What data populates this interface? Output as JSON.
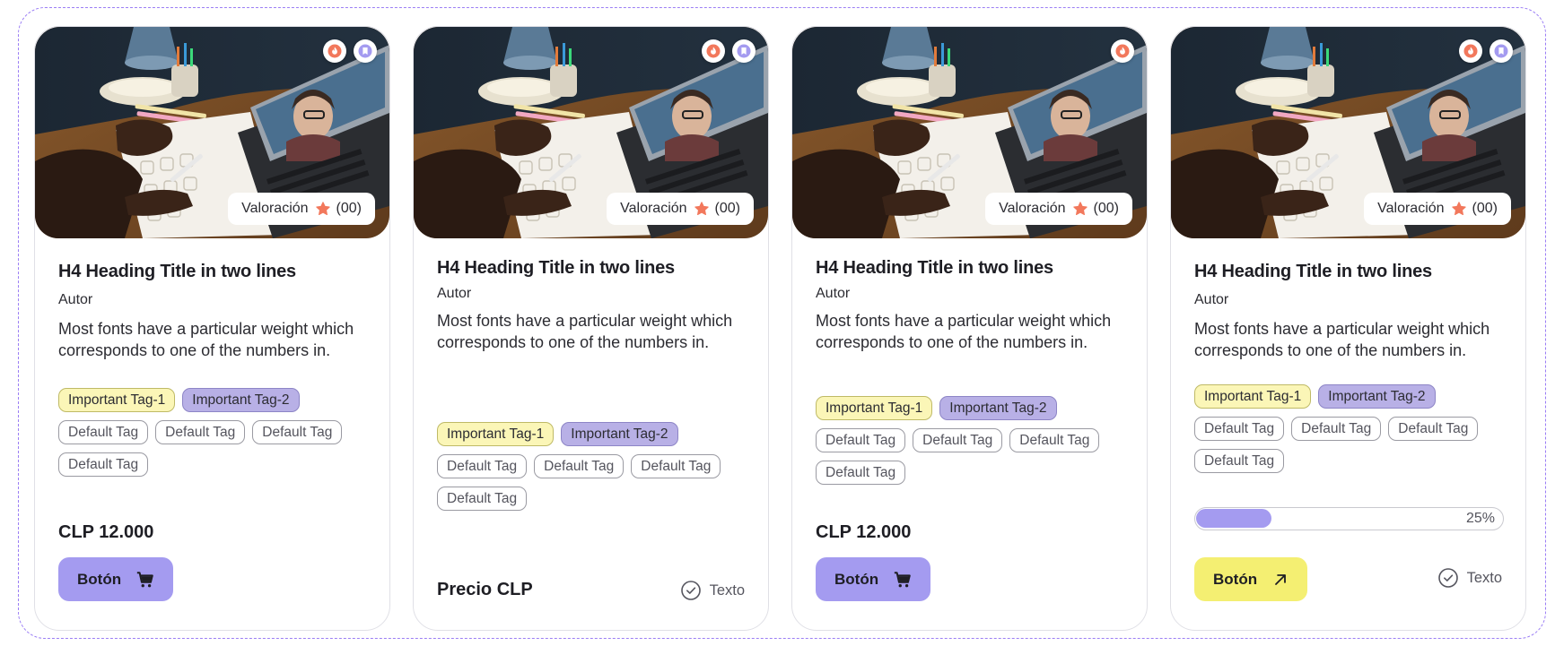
{
  "colors": {
    "brand_purple": "#a49bf0",
    "brand_yellow": "#f4ef72",
    "badge_orange": "#f2785c",
    "star_orange": "#f2785c"
  },
  "cards": [
    {
      "rating": {
        "label": "Valoración",
        "count": "(00)",
        "icon": "star-icon"
      },
      "badges": [
        "flame-icon",
        "bookmark-icon"
      ],
      "title": "H4 Heading Title in two lines",
      "author": "Autor",
      "description": "Most fonts have a particular weight which corresponds to one of the numbers in.",
      "tags": {
        "important": [
          "Important Tag-1",
          "Important Tag-2"
        ],
        "defaults": [
          "Default Tag",
          "Default Tag",
          "Default Tag",
          "Default Tag"
        ]
      },
      "price": "CLP 12.000",
      "button": {
        "label": "Botón",
        "icon": "cart-icon"
      }
    },
    {
      "rating": {
        "label": "Valoración",
        "count": "(00)",
        "icon": "star-icon"
      },
      "badges": [
        "flame-icon",
        "bookmark-icon"
      ],
      "title": "H4 Heading Title in two lines",
      "author": "Autor",
      "description": "Most fonts have a particular weight which corresponds to one of the numbers in.",
      "tags": {
        "important": [
          "Important Tag-1",
          "Important Tag-2"
        ],
        "defaults": [
          "Default Tag",
          "Default Tag",
          "Default Tag",
          "Default Tag"
        ]
      },
      "price": "Precio CLP",
      "status": {
        "label": "Texto",
        "icon": "check-circle-icon"
      }
    },
    {
      "rating": {
        "label": "Valoración",
        "count": "(00)",
        "icon": "star-icon"
      },
      "badges": [
        "flame-icon"
      ],
      "title": "H4 Heading Title in two lines",
      "author": "Autor",
      "description": "Most fonts have a particular weight which corresponds to one of the numbers in.",
      "tags": {
        "important": [
          "Important Tag-1",
          "Important Tag-2"
        ],
        "defaults": [
          "Default Tag",
          "Default Tag",
          "Default Tag",
          "Default Tag"
        ]
      },
      "price": "CLP 12.000",
      "button": {
        "label": "Botón",
        "icon": "cart-icon"
      }
    },
    {
      "rating": {
        "label": "Valoración",
        "count": "(00)",
        "icon": "star-icon"
      },
      "badges": [
        "flame-icon",
        "bookmark-icon"
      ],
      "title": "H4 Heading Title in two lines",
      "author": "Autor",
      "description": "Most fonts have a particular weight which corresponds to one of the numbers in.",
      "tags": {
        "important": [
          "Important Tag-1",
          "Important Tag-2"
        ],
        "defaults": [
          "Default Tag",
          "Default Tag",
          "Default Tag",
          "Default Tag"
        ]
      },
      "progress": {
        "percent": 25,
        "label": "25%"
      },
      "button": {
        "label": "Botón",
        "icon": "arrow-up-right-icon"
      },
      "status": {
        "label": "Texto",
        "icon": "check-circle-icon"
      }
    }
  ]
}
